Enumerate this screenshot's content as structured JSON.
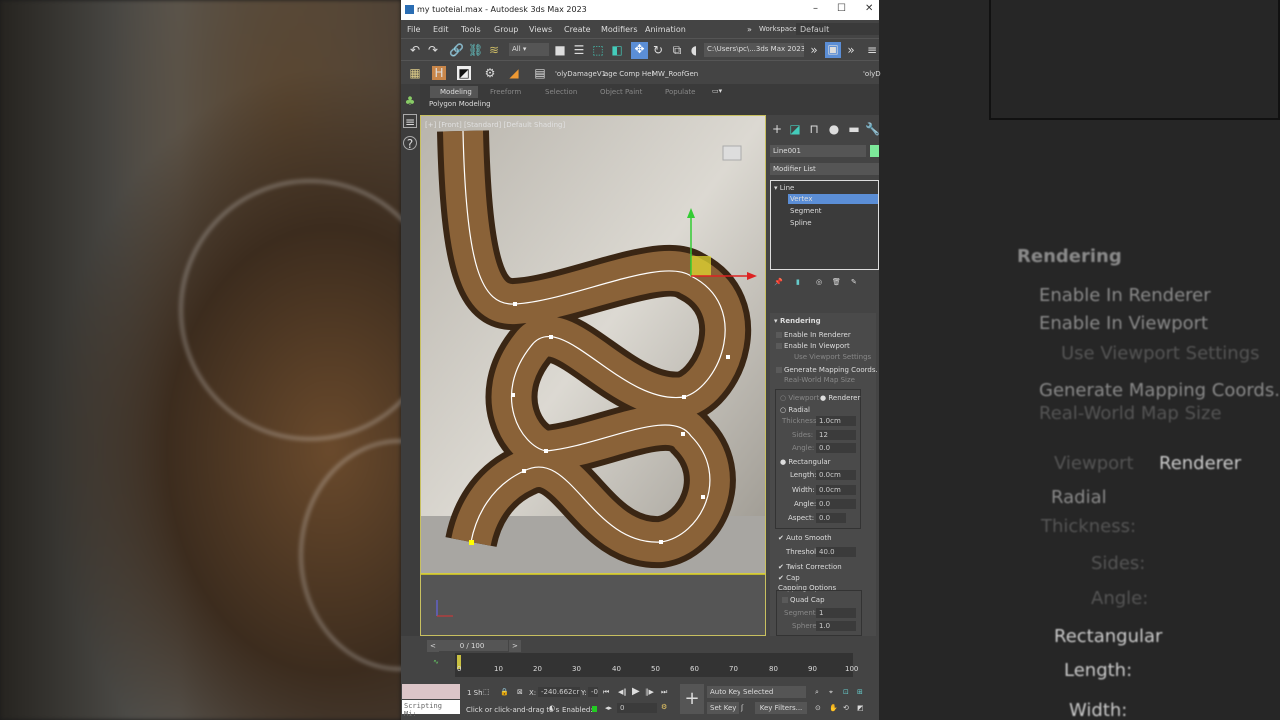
{
  "window": {
    "title": "my tuoteial.max - Autodesk 3ds Max 2023",
    "minimize": "–",
    "maximize": "☐",
    "close": "✕"
  },
  "menu": {
    "items": [
      "File",
      "Edit",
      "Tools",
      "Group",
      "Views",
      "Create",
      "Modifiers",
      "Animation"
    ],
    "more": "»",
    "workspaces_label": "Workspaces:",
    "workspace": "Default"
  },
  "toolbar": {
    "selection_filter": "All",
    "project_path": "C:\\Users\\pc\\...3ds Max 2023",
    "custom_items": [
      "'olyDamageV1",
      "age Comp Hel",
      "MW_RoofGen",
      "'olyD"
    ]
  },
  "ribbon": {
    "tabs": [
      "Modeling",
      "Freeform",
      "Selection",
      "Object Paint",
      "Populate"
    ],
    "active_tab": "Modeling",
    "panel": "Polygon Modeling"
  },
  "viewport": {
    "label": "[+] [Front] [Standard] [Default Shading]"
  },
  "command_panel": {
    "object_name": "Line001",
    "object_color": "#7de89a",
    "modifier_list": "Modifier List",
    "stack": {
      "root": "Line",
      "items": [
        "Vertex",
        "Segment",
        "Spline"
      ],
      "selected": "Vertex"
    },
    "rollout": "Rendering",
    "enable_renderer": "Enable In Renderer",
    "enable_viewport": "Enable In Viewport",
    "use_viewport": "Use Viewport Settings",
    "gen_mapping": "Generate Mapping Coords.",
    "real_world": "Real-World Map Size",
    "viewport_radio": "Viewport",
    "renderer_radio": "Renderer",
    "radial": "Radial",
    "thickness_label": "Thickness:",
    "thickness": "1.0cm",
    "sides_label": "Sides:",
    "sides": "12",
    "angle_label": "Angle:",
    "angle": "0.0",
    "rectangular": "Rectangular",
    "length_label": "Length:",
    "length": "0.0cm",
    "width_label": "Width:",
    "width": "0.0cm",
    "rangle_label": "Angle:",
    "rangle": "0.0",
    "aspect_label": "Aspect:",
    "aspect": "0.0",
    "auto_smooth": "Auto Smooth",
    "threshold_label": "Threshold:",
    "threshold": "40.0",
    "twist": "Twist Correction",
    "cap": "Cap",
    "capping_options": "Capping Options",
    "quad_cap": "Quad Cap",
    "segments_label": "Segments:",
    "segments": "1",
    "sphere_label": "Sphere:",
    "sphere": "1.0"
  },
  "timeline": {
    "frame": "0 / 100",
    "ticks": [
      "0",
      "10",
      "20",
      "30",
      "40",
      "50",
      "60",
      "70",
      "80",
      "90",
      "100"
    ]
  },
  "status": {
    "script_label": "Scripting Mi:",
    "selected_count": "1 Sh",
    "x_label": "X:",
    "x": "-240.662cr",
    "y_label": "Y:",
    "y": "-0",
    "prompt": "Click or click-and-drag to s",
    "enabled_label": "Enabled:",
    "frame_field": "0",
    "auto_key": "Auto Key",
    "set_key": "Set Key",
    "key_mode": "Selected",
    "key_filters": "Key Filters..."
  }
}
